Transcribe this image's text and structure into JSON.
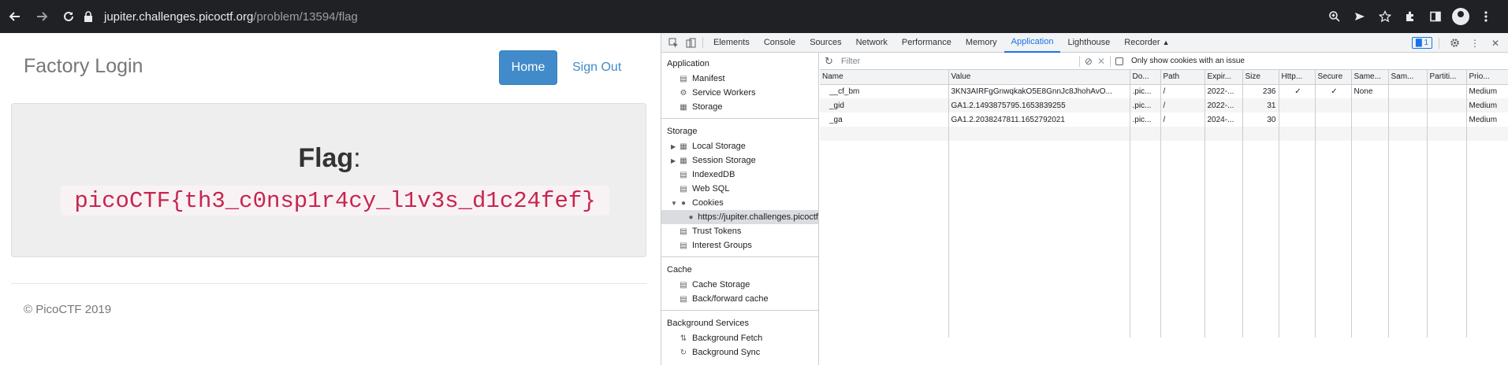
{
  "browser": {
    "url_host": "jupiter.challenges.picoctf.org",
    "url_path": "/problem/13594/flag"
  },
  "site": {
    "brand": "Factory Login",
    "nav_home": "Home",
    "nav_signout": "Sign Out",
    "flag_label": "Flag",
    "flag_colon": ":",
    "flag_value": "picoCTF{th3_c0nsp1r4cy_l1v3s_d1c24fef}",
    "footer": "© PicoCTF 2019"
  },
  "devtools": {
    "tabs": [
      "Elements",
      "Console",
      "Sources",
      "Network",
      "Performance",
      "Memory",
      "Application",
      "Lighthouse",
      "Recorder"
    ],
    "active_tab": "Application",
    "issues_count": "1",
    "sidebar": {
      "application_head": "Application",
      "application_items": [
        "Manifest",
        "Service Workers",
        "Storage"
      ],
      "storage_head": "Storage",
      "storage_items": [
        "Local Storage",
        "Session Storage",
        "IndexedDB",
        "Web SQL",
        "Cookies"
      ],
      "cookie_origin": "https://jupiter.challenges.picoctf",
      "storage_items2": [
        "Trust Tokens",
        "Interest Groups"
      ],
      "cache_head": "Cache",
      "cache_items": [
        "Cache Storage",
        "Back/forward cache"
      ],
      "bg_head": "Background Services",
      "bg_items": [
        "Background Fetch",
        "Background Sync"
      ]
    },
    "filter_placeholder": "Filter",
    "issue_checkbox_label": "Only show cookies with an issue",
    "columns": [
      "Name",
      "Value",
      "Do...",
      "Path",
      "Expir...",
      "Size",
      "Http...",
      "Secure",
      "Same...",
      "Sam...",
      "Partiti...",
      "Prio..."
    ],
    "rows": [
      [
        "__cf_bm",
        "3KN3AIRFgGnwqkakO5E8GnnJc8JhohAvO...",
        ".pic...",
        "/",
        "2022-...",
        "236",
        "✓",
        "✓",
        "None",
        "",
        "",
        "Medium"
      ],
      [
        "_gid",
        "GA1.2.1493875795.1653839255",
        ".pic...",
        "/",
        "2022-...",
        "31",
        "",
        "",
        "",
        "",
        "",
        "Medium"
      ],
      [
        "_ga",
        "GA1.2.2038247811.1652792021",
        ".pic...",
        "/",
        "2024-...",
        "30",
        "",
        "",
        "",
        "",
        "",
        "Medium"
      ]
    ]
  }
}
